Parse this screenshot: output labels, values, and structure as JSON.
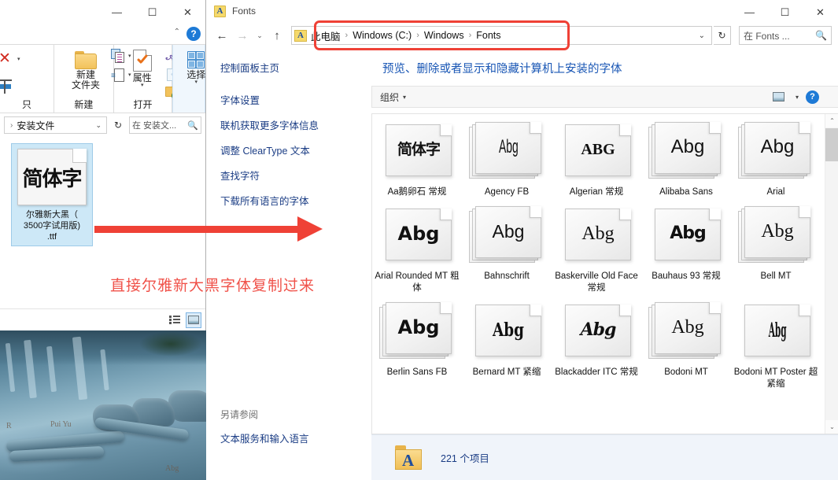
{
  "left_window": {
    "title_controls": {
      "minimize": "—",
      "maximize": "☐",
      "close": "✕"
    },
    "ribbon_help": "?",
    "ribbon_collapse": "⌃",
    "groups": [
      {
        "name_label": "只",
        "label": ""
      },
      {
        "label": "新建",
        "items": [
          {
            "label": "新建\n文件夹",
            "line1": "新建",
            "line2": "文件夹",
            "icon": "folder-icon"
          }
        ]
      },
      {
        "label": "打开",
        "items": [
          {
            "label": "属性",
            "icon": "properties-icon"
          }
        ]
      },
      {
        "label": "",
        "items": [
          {
            "label": "选择",
            "icon": "select-grid-icon"
          }
        ]
      }
    ],
    "address": {
      "crumb": "安装文件",
      "leading_sep": "›",
      "dropdown_caret": "⌄",
      "refresh": "↻"
    },
    "search": {
      "placeholder": "在 安装文...",
      "icon": "search-icon"
    },
    "file": {
      "name": "尔雅新大黑（\n3500字试用版)\n.ttf",
      "name_line1": "尔雅新大黑（",
      "name_line2": "3500字试用版)",
      "name_line3": ".ttf",
      "preview_glyph": "简体字",
      "selected": true
    },
    "view_buttons": [
      {
        "name": "details-view",
        "active": false
      },
      {
        "name": "large-icons-view",
        "active": true
      }
    ]
  },
  "annotations": {
    "arrow_color": "#ef4136",
    "note_text": "直接尔雅新大黑字体复制过来",
    "note_color": "#f0524a",
    "highlight_rect_target": "breadcrumb-path"
  },
  "fonts_window": {
    "title": "Fonts",
    "app_icon_letter": "A",
    "title_controls": {
      "minimize": "—",
      "maximize": "☐",
      "close": "✕"
    },
    "nav": {
      "back": "←",
      "forward": "→",
      "history_caret": "⌄",
      "up": "↑"
    },
    "breadcrumb": {
      "icon_letter": "A",
      "items": [
        "此电脑",
        "Windows (C:)",
        "Windows",
        "Fonts"
      ],
      "separator": "›",
      "dropdown_caret": "⌄"
    },
    "refresh": "↻",
    "search": {
      "placeholder": "在 Fonts ...",
      "icon": "search-icon"
    },
    "sidebar": {
      "home": "控制面板主页",
      "links": [
        "字体设置",
        "联机获取更多字体信息",
        "调整 ClearType 文本",
        "查找字符",
        "下载所有语言的字体"
      ],
      "see_also_header": "另请参阅",
      "see_also_links": [
        "文本服务和输入语言"
      ]
    },
    "heading": "预览、删除或者显示和隐藏计算机上安装的字体",
    "toolbar": {
      "organize": "组织",
      "caret": "▾",
      "view_icon": "view-layout-icon",
      "view_caret": "▾",
      "help": "?"
    },
    "fonts": [
      {
        "name": "Aa鹅卵石 常规",
        "sample": "简体字",
        "style": "smp-hei",
        "stacked": false
      },
      {
        "name": "Agency FB",
        "sample": "Abg",
        "style": "smp-cond",
        "stacked": true
      },
      {
        "name": "Algerian 常规",
        "sample": "ABG",
        "style": "smp-serifcap",
        "stacked": false
      },
      {
        "name": "Alibaba Sans",
        "sample": "Abg",
        "style": "smp-sans",
        "stacked": true
      },
      {
        "name": "Arial",
        "sample": "Abg",
        "style": "smp-sans",
        "stacked": true
      },
      {
        "name": "Arial Rounded MT 粗体",
        "sample": "Abg",
        "style": "smp-sansbold",
        "stacked": false
      },
      {
        "name": "Bahnschrift",
        "sample": "Abg",
        "style": "smp-sanslight",
        "stacked": true
      },
      {
        "name": "Baskerville Old Face 常规",
        "sample": "Abg",
        "style": "smp-serif",
        "stacked": false
      },
      {
        "name": "Bauhaus 93 常规",
        "sample": "Abg",
        "style": "smp-geo",
        "stacked": false
      },
      {
        "name": "Bell MT",
        "sample": "Abg",
        "style": "smp-serif",
        "stacked": true
      },
      {
        "name": "Berlin Sans FB",
        "sample": "Abg",
        "style": "smp-sansbold",
        "stacked": true
      },
      {
        "name": "Bernard MT 紧缩",
        "sample": "Abg",
        "style": "smp-serifbold",
        "stacked": false
      },
      {
        "name": "Blackadder ITC 常规",
        "sample": "Abg",
        "style": "smp-script",
        "stacked": false
      },
      {
        "name": "Bodoni MT",
        "sample": "Abg",
        "style": "smp-didone",
        "stacked": true
      },
      {
        "name": "Bodoni MT Poster 超紧缩",
        "sample": "Abg",
        "style": "smp-poster",
        "stacked": false
      }
    ],
    "scrollbar": {
      "up": "⌃",
      "down": "⌄"
    },
    "status": {
      "count_text": "221 个项目",
      "folder_letter": "A"
    }
  }
}
